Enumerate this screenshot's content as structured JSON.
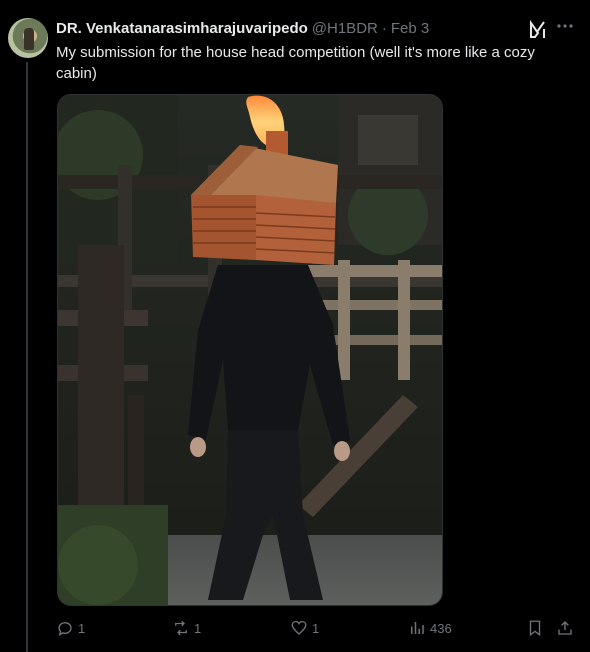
{
  "author": {
    "name": "DR. Venkatanarasimharajuvaripedo",
    "handle": "@H1BDR",
    "separator": "·",
    "date": "Feb 3"
  },
  "post": {
    "text": "My submission for the house head competition (well it's more like a cozy cabin)"
  },
  "header_icons": {
    "grok": "grok-icon",
    "more": "more-options-icon"
  },
  "actions": {
    "reply_count": "1",
    "repost_count": "1",
    "like_count": "1",
    "views_count": "436"
  },
  "colors": {
    "background": "#000000",
    "text_primary": "#e7e9ea",
    "text_secondary": "#71767b",
    "border": "#2f3336"
  }
}
